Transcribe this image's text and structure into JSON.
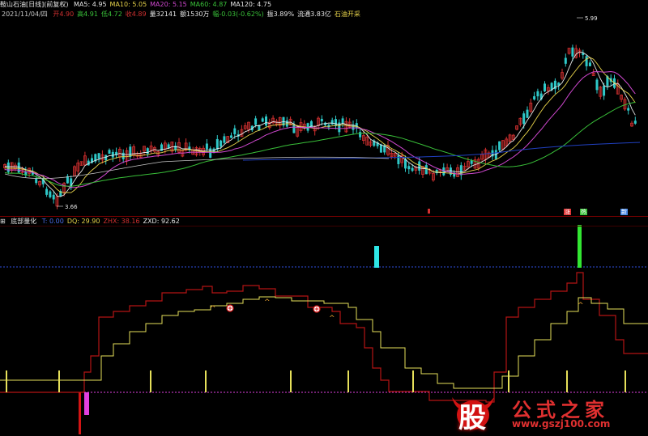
{
  "top_header": {
    "title": "鞍山石油[日线](前复权)",
    "items": [
      {
        "label": "MA5:",
        "value": "4.95",
        "color": "#e6e6e6"
      },
      {
        "label": "MA10:",
        "value": "5.05",
        "color": "#e6d24a"
      },
      {
        "label": "MA20:",
        "value": "5.15",
        "color": "#d048d0"
      },
      {
        "label": "MA60:",
        "value": "4.87",
        "color": "#39c039"
      },
      {
        "label": "MA120:",
        "value": "4.75",
        "color": "#e6e6e6"
      }
    ]
  },
  "date_line": {
    "date": "2021/11/04/四",
    "fields": [
      {
        "text": "开4.90",
        "color": "#d03030"
      },
      {
        "text": "高4.91",
        "color": "#39c039"
      },
      {
        "text": "低4.72",
        "color": "#39c039"
      },
      {
        "text": "收4.89",
        "color": "#d03030"
      },
      {
        "text": "量32141",
        "color": "#e6e6e6"
      },
      {
        "text": "额1530万",
        "color": "#e6e6e6"
      },
      {
        "text": "幅-0.03(-0.62%)",
        "color": "#39c039"
      },
      {
        "text": "振3.89%",
        "color": "#e6e6e6"
      },
      {
        "text": "流通3.83亿",
        "color": "#e6e6e6"
      },
      {
        "text": "石油开采",
        "color": "#e6d24a"
      }
    ]
  },
  "price_labels": {
    "high": "5.99",
    "low": "3.66"
  },
  "event_tags": [
    {
      "text": "涨",
      "color": "#e03030"
    },
    {
      "text": "热",
      "color": "#39c039"
    },
    {
      "text": "新",
      "color": "#4a8ae6"
    }
  ],
  "indicator_header": {
    "name": "底部量化",
    "items": [
      {
        "label": "T:",
        "value": "0.00",
        "color": "#4a6ae6"
      },
      {
        "label": "DQ:",
        "value": "29.90",
        "color": "#e6d24a"
      },
      {
        "label": "ZHX:",
        "value": "38.16",
        "color": "#d03030"
      },
      {
        "label": "ZXD:",
        "value": "92.62",
        "color": "#e6e6e6"
      }
    ]
  },
  "watermark": {
    "logo": "股",
    "title": "公式之家",
    "url": "www.gszj100.com"
  },
  "colors": {
    "up": "#d43030",
    "down": "#2fc8c8",
    "ma5": "#e6e6e6",
    "ma10": "#e6d24a",
    "ma20": "#d048d0",
    "ma60": "#39c039",
    "ma120": "#2040c0",
    "dq": "#e6e05a",
    "zhx": "#b41414",
    "pink": "#e040e0",
    "cyan": "#2ee6e6",
    "green": "#32e632"
  }
}
